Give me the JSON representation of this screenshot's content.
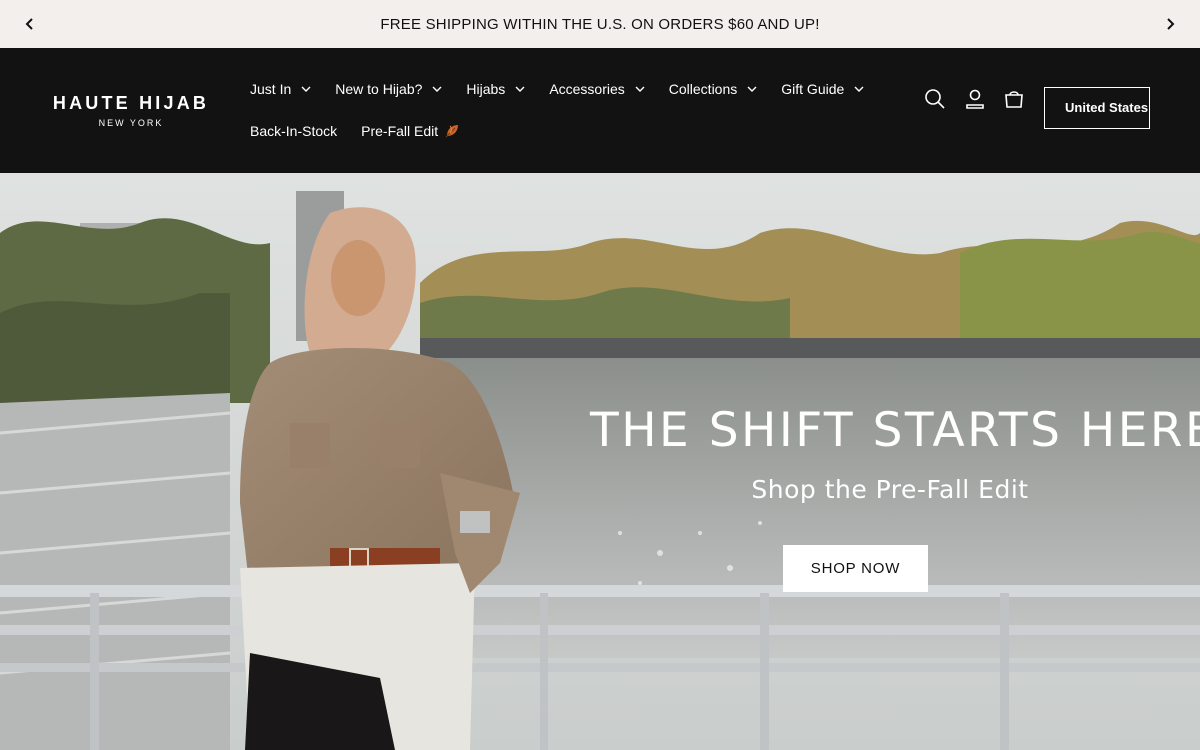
{
  "announcement": {
    "text": "FREE SHIPPING WITHIN THE U.S. ON ORDERS $60 AND UP!",
    "prev_icon": "chevron-left-icon",
    "next_icon": "chevron-right-icon"
  },
  "header": {
    "logo_main": "HAUTE HIJAB",
    "logo_sub": "NEW YORK",
    "nav_row1": [
      {
        "label": "Just In",
        "has_dropdown": true
      },
      {
        "label": "New to Hijab?",
        "has_dropdown": true
      },
      {
        "label": "Hijabs",
        "has_dropdown": true
      },
      {
        "label": "Accessories",
        "has_dropdown": true
      },
      {
        "label": "Collections",
        "has_dropdown": true
      },
      {
        "label": "Gift Guide",
        "has_dropdown": true
      }
    ],
    "nav_row2": [
      {
        "label": "Back-In-Stock",
        "has_dropdown": false
      },
      {
        "label": "Pre-Fall Edit",
        "has_dropdown": false,
        "icon": "autumn-leaf-icon"
      }
    ],
    "icons": [
      "search-icon",
      "account-icon",
      "cart-icon"
    ],
    "country": "United States",
    "colors": {
      "background": "#121212",
      "text": "#ffffff"
    }
  },
  "hero": {
    "title": "THE SHIFT STARTS HERE",
    "subtitle": "Shop the Pre-Fall Edit",
    "cta_label": "SHOP NOW"
  },
  "colors": {
    "announcement_bg": "#f3efec",
    "header_bg": "#121212",
    "button_bg": "#ffffff"
  }
}
